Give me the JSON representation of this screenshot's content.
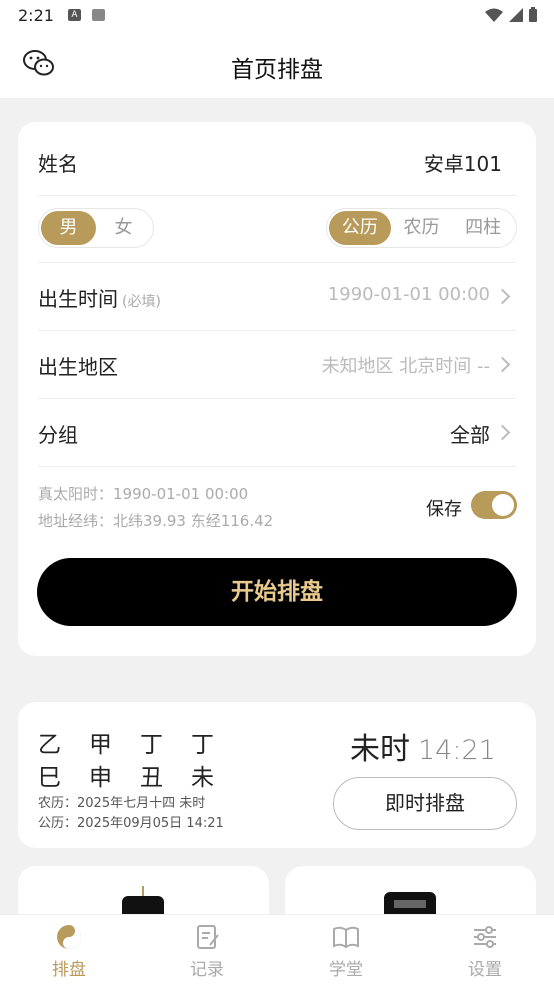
{
  "status_bar": {
    "time": "2:21"
  },
  "header": {
    "title": "首页排盘"
  },
  "form": {
    "name_label": "姓名",
    "name_value": "安卓101",
    "gender": {
      "male": "男",
      "female": "女",
      "selected": "男"
    },
    "calendar": {
      "options": [
        "公历",
        "农历",
        "四柱"
      ],
      "selected": "公历"
    },
    "birth_time_label": "出生时间",
    "birth_time_hint": "(必填)",
    "birth_time_value": "1990-01-01 00:00",
    "birth_region_label": "出生地区",
    "birth_region_value": "未知地区 北京时间 --",
    "group_label": "分组",
    "group_value": "全部",
    "true_solar_time": "真太阳时：1990-01-01 00:00",
    "coordinates": "地址经纬：北纬39.93 东经116.42",
    "save_label": "保存",
    "save_enabled": true,
    "start_button": "开始排盘"
  },
  "current": {
    "stems": [
      "乙",
      "甲",
      "丁",
      "丁"
    ],
    "branches": [
      "巳",
      "申",
      "丑",
      "未"
    ],
    "lunar": "农历：2025年七月十四 未时",
    "solar": "公历：2025年09月05日 14:21",
    "hour_name": "未时",
    "clock": "14:21",
    "instant_button": "即时排盘"
  },
  "tabs": [
    {
      "label": "排盘",
      "icon": "yin-yang-icon",
      "active": true
    },
    {
      "label": "记录",
      "icon": "notes-icon",
      "active": false
    },
    {
      "label": "学堂",
      "icon": "book-icon",
      "active": false
    },
    {
      "label": "设置",
      "icon": "settings-sliders-icon",
      "active": false
    }
  ],
  "colors": {
    "accent": "#b89a5a",
    "button_text": "#e8c98e",
    "background": "#f1f1f1"
  }
}
